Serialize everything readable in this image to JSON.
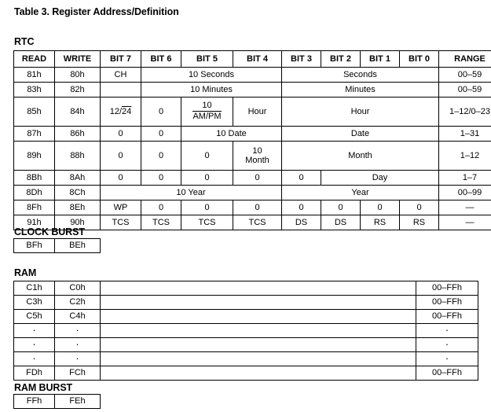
{
  "document": {
    "title": "Table 3. Register Address/Definition"
  },
  "sections": {
    "rtc": {
      "label": "RTC",
      "columns": [
        "READ",
        "WRITE",
        "BIT 7",
        "BIT 6",
        "BIT 5",
        "BIT 4",
        "BIT 3",
        "BIT 2",
        "BIT 1",
        "BIT 0",
        "RANGE"
      ],
      "rows": [
        {
          "read": "81h",
          "write": "80h",
          "bit7": "CH",
          "group_b6_b4": "10 Seconds",
          "group_b3_b0": "Seconds",
          "range": "00–59"
        },
        {
          "read": "83h",
          "write": "82h",
          "bit7": "",
          "group_b6_b4": "10 Minutes",
          "group_b3_b0": "Minutes",
          "range": "00–59"
        },
        {
          "read": "85h",
          "write": "84h",
          "bit7_a": "12/",
          "bit7_b": "24",
          "bit6": "0",
          "bit5_num": "10",
          "bit5_den": "AM/PM",
          "bit4": "Hour",
          "group_b3_b0": "Hour",
          "range": "1–12/0–23"
        },
        {
          "read": "87h",
          "write": "86h",
          "bit7": "0",
          "bit6": "0",
          "group_b5_b4": "10 Date",
          "group_b3_b0": "Date",
          "range": "1–31"
        },
        {
          "read": "89h",
          "write": "88h",
          "bit7": "0",
          "bit6": "0",
          "bit5": "0",
          "bit4_line1": "10",
          "bit4_line2": "Month",
          "group_b3_b0": "Month",
          "range": "1–12"
        },
        {
          "read": "8Bh",
          "write": "8Ah",
          "bit7": "0",
          "bit6": "0",
          "bit5": "0",
          "bit4": "0",
          "bit3": "0",
          "group_b2_b0": "Day",
          "range": "1–7"
        },
        {
          "read": "8Dh",
          "write": "8Ch",
          "group_b7_b4": "10 Year",
          "group_b3_b0": "Year",
          "range": "00–99"
        },
        {
          "read": "8Fh",
          "write": "8Eh",
          "bit7": "WP",
          "bit6": "0",
          "bit5": "0",
          "bit4": "0",
          "bit3": "0",
          "bit2": "0",
          "bit1": "0",
          "bit0": "0",
          "range": "—"
        },
        {
          "read": "91h",
          "write": "90h",
          "bit7": "TCS",
          "bit6": "TCS",
          "bit5": "TCS",
          "bit4": "TCS",
          "bit3": "DS",
          "bit2": "DS",
          "bit1": "RS",
          "bit0": "RS",
          "range": "—"
        }
      ]
    },
    "clock_burst": {
      "label": "CLOCK BURST",
      "read": "BFh",
      "write": "BEh"
    },
    "ram": {
      "label": "RAM",
      "rows": [
        {
          "read": "C1h",
          "write": "C0h",
          "data": "",
          "range": "00–FFh"
        },
        {
          "read": "C3h",
          "write": "C2h",
          "data": "",
          "range": "00–FFh"
        },
        {
          "read": "C5h",
          "write": "C4h",
          "data": "",
          "range": "00–FFh"
        },
        {
          "read": "·",
          "write": "·",
          "data": "",
          "range": "·"
        },
        {
          "read": "·",
          "write": "·",
          "data": "",
          "range": "·"
        },
        {
          "read": "·",
          "write": "·",
          "data": "",
          "range": "·"
        },
        {
          "read": "FDh",
          "write": "FCh",
          "data": "",
          "range": "00–FFh"
        }
      ]
    },
    "ram_burst": {
      "label": "RAM BURST",
      "read": "FFh",
      "write": "FEh"
    }
  }
}
